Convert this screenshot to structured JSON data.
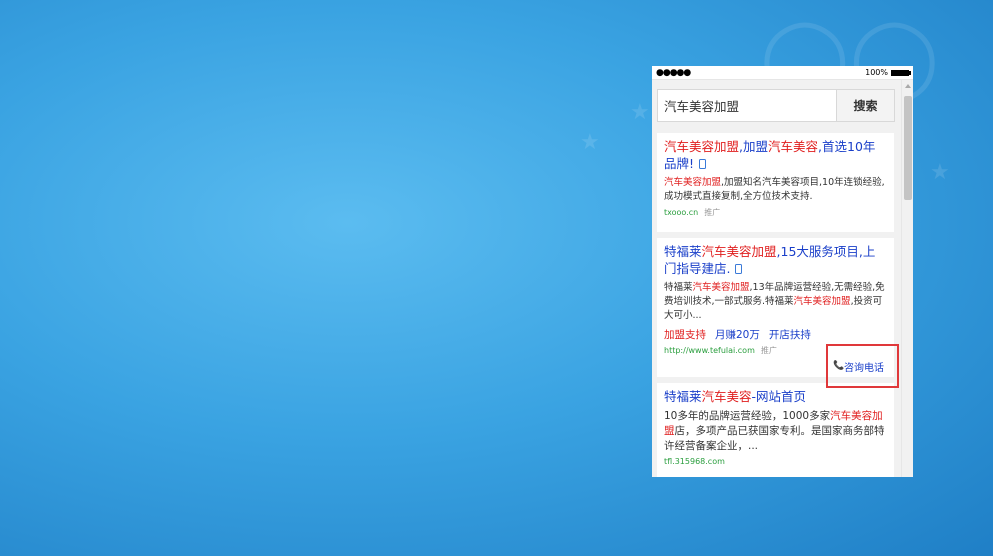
{
  "status": {
    "signal": "●●●●●",
    "battery": "100%"
  },
  "search": {
    "value": "汽车美容加盟",
    "button": "搜索"
  },
  "results": [
    {
      "title_hl": "汽车美容加盟",
      "title_rest": ",加盟",
      "title_hl2": "汽车美容",
      "title_rest2": ",首选10年品牌!",
      "desc_hl": "汽车美容加盟",
      "desc_rest": ",加盟知名汽车美容项目,10年连锁经验,成功模式直接复制,全方位技术支持.",
      "url": "txooo.cn",
      "tag": "推广"
    },
    {
      "title_pre": "特福莱",
      "title_hl": "汽车美容加盟",
      "title_rest": ",15大服务项目,上门指导建店.",
      "desc_pre": "特福莱",
      "desc_hl": "汽车美容加盟",
      "desc_mid": ",13年品牌运营经验,无需经验,免费培训技术,一部式服务.特福莱",
      "desc_hl2": "汽车美容加盟",
      "desc_rest": ",投资可大可小...",
      "link1": "加盟支持",
      "link2": "月赚20万",
      "link3": "开店扶持",
      "url": "http://www.tefulai.com",
      "tag": "推广",
      "call": "咨询电话"
    },
    {
      "title_pre": "特福莱",
      "title_hl": "汽车美容",
      "title_rest": "-网站首页",
      "desc_pre": "10多年的品牌运营经验，1000多家",
      "desc_hl": "汽车美容加盟",
      "desc_rest": "店，多项产品已获国家专利。是国家商务部特许经营备案企业，...",
      "url": "tfl.315968.com"
    }
  ]
}
